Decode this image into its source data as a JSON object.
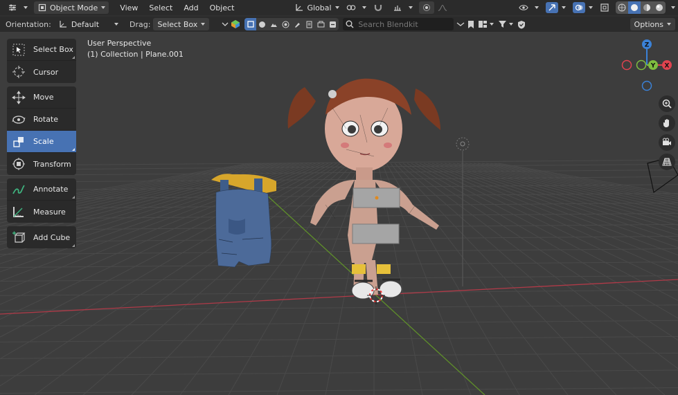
{
  "header": {
    "editor_type_icon": "editor-type-icon",
    "mode": "Object Mode",
    "menus": [
      "View",
      "Select",
      "Add",
      "Object"
    ],
    "transform_orientation": "Global"
  },
  "toolrow": {
    "orientation_label": "Orientation:",
    "orientation_value": "Default",
    "drag_label": "Drag:",
    "drag_value": "Select Box",
    "search_placeholder": "Search Blendkit",
    "options_label": "Options"
  },
  "viewport": {
    "view_name": "User Perspective",
    "collection_info": "(1) Collection | Plane.001"
  },
  "toolbar": {
    "groups": [
      [
        {
          "label": "Select Box",
          "icon": "select-box-icon"
        },
        {
          "label": "Cursor",
          "icon": "cursor-icon"
        }
      ],
      [
        {
          "label": "Move",
          "icon": "move-icon"
        },
        {
          "label": "Rotate",
          "icon": "rotate-icon"
        },
        {
          "label": "Scale",
          "icon": "scale-icon",
          "active": true
        },
        {
          "label": "Transform",
          "icon": "transform-icon"
        }
      ],
      [
        {
          "label": "Annotate",
          "icon": "annotate-icon"
        },
        {
          "label": "Measure",
          "icon": "measure-icon"
        }
      ],
      [
        {
          "label": "Add Cube",
          "icon": "add-cube-icon"
        }
      ]
    ]
  },
  "gizmo": {
    "axes": [
      "X",
      "Y",
      "Z"
    ],
    "colors": {
      "x": "#e0434f",
      "y": "#7fbf3f",
      "z": "#3b82d8"
    }
  },
  "colors": {
    "accent": "#4772b3",
    "header_bg": "#2b2b2b",
    "viewport_bg": "#3d3d3d"
  }
}
